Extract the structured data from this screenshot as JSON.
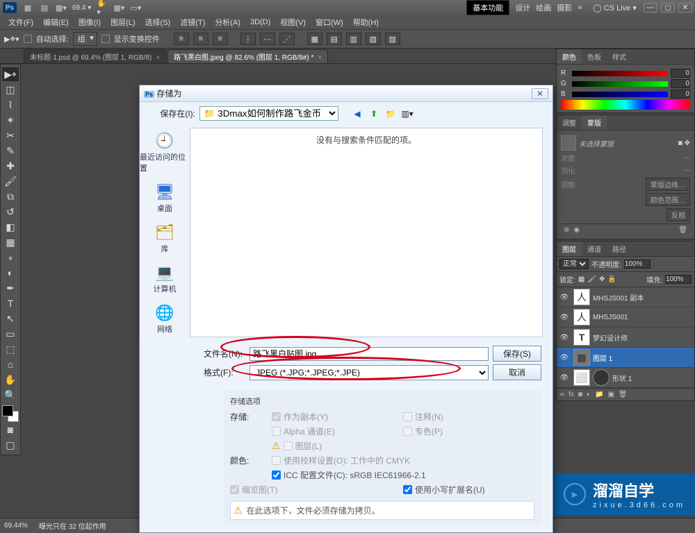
{
  "titlebar": {
    "logo": "Ps",
    "zoom": "69.4",
    "workspace_essentials": "基本功能",
    "wk_design": "设计",
    "wk_paint": "绘画",
    "wk_photo": "摄影",
    "cslive": "CS Live"
  },
  "menu": {
    "file": "文件(F)",
    "edit": "编辑(E)",
    "image": "图像(I)",
    "layer": "图层(L)",
    "select": "选择(S)",
    "filter": "滤镜(T)",
    "analysis": "分析(A)",
    "threeD": "3D(D)",
    "view": "视图(V)",
    "window": "窗口(W)",
    "help": "帮助(H)"
  },
  "options": {
    "autosel_label": "自动选择:",
    "autosel_value": "组",
    "transform_label": "显示变换控件"
  },
  "tabs": [
    {
      "label": "未标题-1.psd @ 69.4% (图层 1, RGB/8)",
      "active": false
    },
    {
      "label": "路飞黑白图.jpeg @ 82.6% (图层 1, RGB/8#) *",
      "active": true
    }
  ],
  "status": {
    "zoom": "69.44%",
    "info": "曝光只在 32 位起作用"
  },
  "color": {
    "tab_color": "颜色",
    "tab_swatch": "色板",
    "tab_style": "样式",
    "r_label": "R",
    "r_val": "0",
    "g_label": "G",
    "g_val": "0",
    "b_label": "B",
    "b_val": "0"
  },
  "mask": {
    "tab_adjust": "调整",
    "tab_mask": "蒙版",
    "unselected": "未选择蒙版",
    "density": "浓度:",
    "feather": "羽化:",
    "refine": "调整:",
    "btn_edge": "蒙版边缘…",
    "btn_range": "颜色范围…",
    "btn_invert": "反相"
  },
  "layers": {
    "tab_layer": "图层",
    "tab_channel": "通道",
    "tab_path": "路径",
    "blend": "正常",
    "opacity_label": "不透明度:",
    "opacity_val": "100%",
    "lock_label": "锁定:",
    "fill_label": "填充:",
    "fill_val": "100%",
    "items": [
      {
        "name": "MHSJS001 副本"
      },
      {
        "name": "MHSJS001"
      },
      {
        "name": "梦幻设计师"
      },
      {
        "name": "图层 1"
      },
      {
        "name": "形状 1"
      }
    ]
  },
  "dialog": {
    "title": "存储为",
    "savein_label": "保存在(I):",
    "savein_value": "3Dmax如何制作路飞金币",
    "places": {
      "recent": "最近访问的位置",
      "desktop": "桌面",
      "library": "库",
      "computer": "计算机",
      "network": "网络"
    },
    "empty_msg": "没有与搜索条件匹配的项。",
    "filename_label": "文件名(N):",
    "filename_value": "路飞黑白贴图.jpg",
    "format_label": "格式(F):",
    "format_value": "JPEG (*.JPG;*.JPEG;*.JPE)",
    "btn_save": "保存(S)",
    "btn_cancel": "取消",
    "opts_header": "存储选项",
    "opts_store": "存储:",
    "chk_copy": "作为副本(Y)",
    "chk_notes": "注释(N)",
    "chk_alpha": "Alpha 通道(E)",
    "chk_spot": "专色(P)",
    "chk_layers": "图层(L)",
    "opts_color": "颜色:",
    "chk_proof": "使用校样设置(O): 工作中的 CMYK",
    "chk_icc": "ICC 配置文件(C): sRGB IEC61966-2.1",
    "chk_thumb": "缩览图(T)",
    "chk_lcext": "使用小写扩展名(U)",
    "warning": "在此选项下，文件必须存储为拷贝。"
  },
  "watermark": {
    "big": "溜溜自学",
    "url": "zixue.3d66.com"
  },
  "icons": {
    "search": "🔍",
    "world": "🌐",
    "up": "⬆",
    "newf": "📁",
    "views": "▥"
  }
}
